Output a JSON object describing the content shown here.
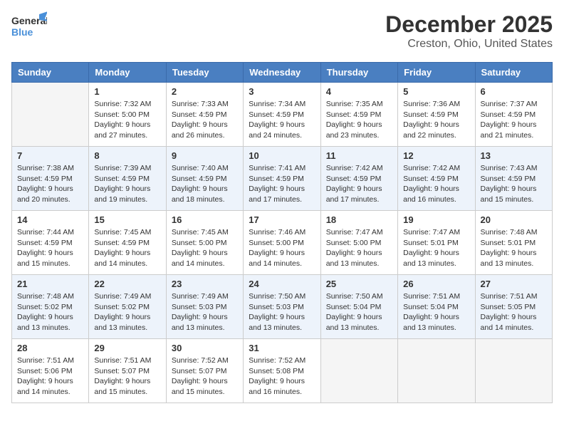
{
  "header": {
    "logo_line1": "General",
    "logo_line2": "Blue",
    "month": "December 2025",
    "location": "Creston, Ohio, United States"
  },
  "days_of_week": [
    "Sunday",
    "Monday",
    "Tuesday",
    "Wednesday",
    "Thursday",
    "Friday",
    "Saturday"
  ],
  "weeks": [
    [
      {
        "day": "",
        "info": ""
      },
      {
        "day": "1",
        "info": "Sunrise: 7:32 AM\nSunset: 5:00 PM\nDaylight: 9 hours\nand 27 minutes."
      },
      {
        "day": "2",
        "info": "Sunrise: 7:33 AM\nSunset: 4:59 PM\nDaylight: 9 hours\nand 26 minutes."
      },
      {
        "day": "3",
        "info": "Sunrise: 7:34 AM\nSunset: 4:59 PM\nDaylight: 9 hours\nand 24 minutes."
      },
      {
        "day": "4",
        "info": "Sunrise: 7:35 AM\nSunset: 4:59 PM\nDaylight: 9 hours\nand 23 minutes."
      },
      {
        "day": "5",
        "info": "Sunrise: 7:36 AM\nSunset: 4:59 PM\nDaylight: 9 hours\nand 22 minutes."
      },
      {
        "day": "6",
        "info": "Sunrise: 7:37 AM\nSunset: 4:59 PM\nDaylight: 9 hours\nand 21 minutes."
      }
    ],
    [
      {
        "day": "7",
        "info": "Sunrise: 7:38 AM\nSunset: 4:59 PM\nDaylight: 9 hours\nand 20 minutes."
      },
      {
        "day": "8",
        "info": "Sunrise: 7:39 AM\nSunset: 4:59 PM\nDaylight: 9 hours\nand 19 minutes."
      },
      {
        "day": "9",
        "info": "Sunrise: 7:40 AM\nSunset: 4:59 PM\nDaylight: 9 hours\nand 18 minutes."
      },
      {
        "day": "10",
        "info": "Sunrise: 7:41 AM\nSunset: 4:59 PM\nDaylight: 9 hours\nand 17 minutes."
      },
      {
        "day": "11",
        "info": "Sunrise: 7:42 AM\nSunset: 4:59 PM\nDaylight: 9 hours\nand 17 minutes."
      },
      {
        "day": "12",
        "info": "Sunrise: 7:42 AM\nSunset: 4:59 PM\nDaylight: 9 hours\nand 16 minutes."
      },
      {
        "day": "13",
        "info": "Sunrise: 7:43 AM\nSunset: 4:59 PM\nDaylight: 9 hours\nand 15 minutes."
      }
    ],
    [
      {
        "day": "14",
        "info": "Sunrise: 7:44 AM\nSunset: 4:59 PM\nDaylight: 9 hours\nand 15 minutes."
      },
      {
        "day": "15",
        "info": "Sunrise: 7:45 AM\nSunset: 4:59 PM\nDaylight: 9 hours\nand 14 minutes."
      },
      {
        "day": "16",
        "info": "Sunrise: 7:45 AM\nSunset: 5:00 PM\nDaylight: 9 hours\nand 14 minutes."
      },
      {
        "day": "17",
        "info": "Sunrise: 7:46 AM\nSunset: 5:00 PM\nDaylight: 9 hours\nand 14 minutes."
      },
      {
        "day": "18",
        "info": "Sunrise: 7:47 AM\nSunset: 5:00 PM\nDaylight: 9 hours\nand 13 minutes."
      },
      {
        "day": "19",
        "info": "Sunrise: 7:47 AM\nSunset: 5:01 PM\nDaylight: 9 hours\nand 13 minutes."
      },
      {
        "day": "20",
        "info": "Sunrise: 7:48 AM\nSunset: 5:01 PM\nDaylight: 9 hours\nand 13 minutes."
      }
    ],
    [
      {
        "day": "21",
        "info": "Sunrise: 7:48 AM\nSunset: 5:02 PM\nDaylight: 9 hours\nand 13 minutes."
      },
      {
        "day": "22",
        "info": "Sunrise: 7:49 AM\nSunset: 5:02 PM\nDaylight: 9 hours\nand 13 minutes."
      },
      {
        "day": "23",
        "info": "Sunrise: 7:49 AM\nSunset: 5:03 PM\nDaylight: 9 hours\nand 13 minutes."
      },
      {
        "day": "24",
        "info": "Sunrise: 7:50 AM\nSunset: 5:03 PM\nDaylight: 9 hours\nand 13 minutes."
      },
      {
        "day": "25",
        "info": "Sunrise: 7:50 AM\nSunset: 5:04 PM\nDaylight: 9 hours\nand 13 minutes."
      },
      {
        "day": "26",
        "info": "Sunrise: 7:51 AM\nSunset: 5:04 PM\nDaylight: 9 hours\nand 13 minutes."
      },
      {
        "day": "27",
        "info": "Sunrise: 7:51 AM\nSunset: 5:05 PM\nDaylight: 9 hours\nand 14 minutes."
      }
    ],
    [
      {
        "day": "28",
        "info": "Sunrise: 7:51 AM\nSunset: 5:06 PM\nDaylight: 9 hours\nand 14 minutes."
      },
      {
        "day": "29",
        "info": "Sunrise: 7:51 AM\nSunset: 5:07 PM\nDaylight: 9 hours\nand 15 minutes."
      },
      {
        "day": "30",
        "info": "Sunrise: 7:52 AM\nSunset: 5:07 PM\nDaylight: 9 hours\nand 15 minutes."
      },
      {
        "day": "31",
        "info": "Sunrise: 7:52 AM\nSunset: 5:08 PM\nDaylight: 9 hours\nand 16 minutes."
      },
      {
        "day": "",
        "info": ""
      },
      {
        "day": "",
        "info": ""
      },
      {
        "day": "",
        "info": ""
      }
    ]
  ]
}
